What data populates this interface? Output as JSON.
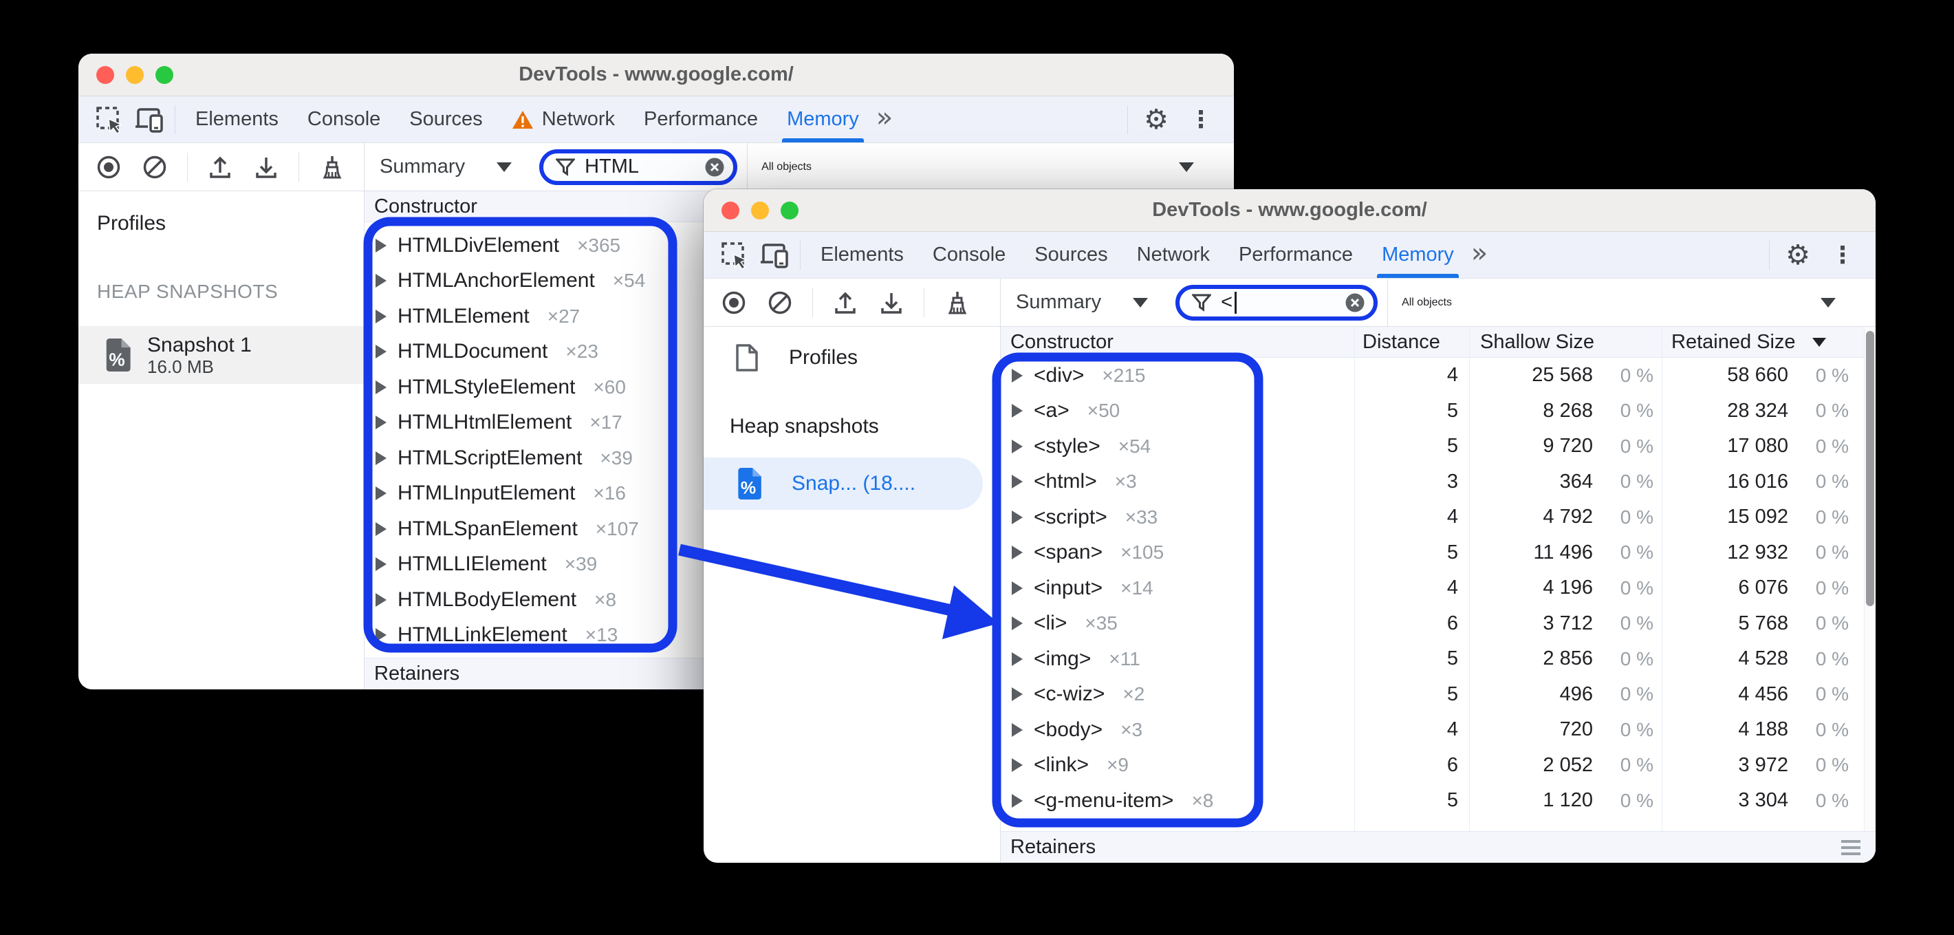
{
  "colors": {
    "accent_blue": "#1a73e8",
    "annotation_blue": "#1538e8",
    "warning_orange": "#e8710a",
    "traffic_red": "#ff5f57",
    "traffic_yellow": "#febc2e",
    "traffic_green": "#28c840"
  },
  "icons": {
    "gear": "⚙",
    "kebab": "⋮",
    "more_tabs": "»"
  },
  "back_window": {
    "title": "DevTools - www.google.com/",
    "tabs": [
      "Elements",
      "Console",
      "Sources",
      "Network",
      "Performance",
      "Memory"
    ],
    "selected_tab": "Memory",
    "toolbar": {
      "summary": "Summary",
      "filter": "HTML",
      "objects": "All objects"
    },
    "sidebar": {
      "profiles": "Profiles",
      "section": "HEAP SNAPSHOTS",
      "snapshot_name": "Snapshot 1",
      "snapshot_size": "16.0 MB"
    },
    "grid": {
      "constructor": "Constructor",
      "retainers": "Retainers",
      "rows": [
        {
          "name": "HTMLDivElement",
          "count": "×365"
        },
        {
          "name": "HTMLAnchorElement",
          "count": "×54"
        },
        {
          "name": "HTMLElement",
          "count": "×27"
        },
        {
          "name": "HTMLDocument",
          "count": "×23"
        },
        {
          "name": "HTMLStyleElement",
          "count": "×60"
        },
        {
          "name": "HTMLHtmlElement",
          "count": "×17"
        },
        {
          "name": "HTMLScriptElement",
          "count": "×39"
        },
        {
          "name": "HTMLInputElement",
          "count": "×16"
        },
        {
          "name": "HTMLSpanElement",
          "count": "×107"
        },
        {
          "name": "HTMLLIElement",
          "count": "×39"
        },
        {
          "name": "HTMLBodyElement",
          "count": "×8"
        },
        {
          "name": "HTMLLinkElement",
          "count": "×13"
        }
      ]
    }
  },
  "front_window": {
    "title": "DevTools - www.google.com/",
    "tabs": [
      "Elements",
      "Console",
      "Sources",
      "Network",
      "Performance",
      "Memory"
    ],
    "selected_tab": "Memory",
    "toolbar": {
      "summary": "Summary",
      "filter": "<",
      "objects": "All objects"
    },
    "sidebar": {
      "profiles": "Profiles",
      "section": "Heap snapshots",
      "snapshot_name": "Snap... (18...."
    },
    "grid": {
      "constructor": "Constructor",
      "distance": "Distance",
      "shallow": "Shallow Size",
      "retained": "Retained Size",
      "retainers": "Retainers",
      "rows": [
        {
          "name": "<div>",
          "count": "×215",
          "distance": "4",
          "shallow": "25 568",
          "shallow_pct": "0 %",
          "retained": "58 660",
          "retained_pct": "0 %"
        },
        {
          "name": "<a>",
          "count": "×50",
          "distance": "5",
          "shallow": "8 268",
          "shallow_pct": "0 %",
          "retained": "28 324",
          "retained_pct": "0 %"
        },
        {
          "name": "<style>",
          "count": "×54",
          "distance": "5",
          "shallow": "9 720",
          "shallow_pct": "0 %",
          "retained": "17 080",
          "retained_pct": "0 %"
        },
        {
          "name": "<html>",
          "count": "×3",
          "distance": "3",
          "shallow": "364",
          "shallow_pct": "0 %",
          "retained": "16 016",
          "retained_pct": "0 %"
        },
        {
          "name": "<script>",
          "count": "×33",
          "distance": "4",
          "shallow": "4 792",
          "shallow_pct": "0 %",
          "retained": "15 092",
          "retained_pct": "0 %"
        },
        {
          "name": "<span>",
          "count": "×105",
          "distance": "5",
          "shallow": "11 496",
          "shallow_pct": "0 %",
          "retained": "12 932",
          "retained_pct": "0 %"
        },
        {
          "name": "<input>",
          "count": "×14",
          "distance": "4",
          "shallow": "4 196",
          "shallow_pct": "0 %",
          "retained": "6 076",
          "retained_pct": "0 %"
        },
        {
          "name": "<li>",
          "count": "×35",
          "distance": "6",
          "shallow": "3 712",
          "shallow_pct": "0 %",
          "retained": "5 768",
          "retained_pct": "0 %"
        },
        {
          "name": "<img>",
          "count": "×11",
          "distance": "5",
          "shallow": "2 856",
          "shallow_pct": "0 %",
          "retained": "4 528",
          "retained_pct": "0 %"
        },
        {
          "name": "<c-wiz>",
          "count": "×2",
          "distance": "5",
          "shallow": "496",
          "shallow_pct": "0 %",
          "retained": "4 456",
          "retained_pct": "0 %"
        },
        {
          "name": "<body>",
          "count": "×3",
          "distance": "4",
          "shallow": "720",
          "shallow_pct": "0 %",
          "retained": "4 188",
          "retained_pct": "0 %"
        },
        {
          "name": "<link>",
          "count": "×9",
          "distance": "6",
          "shallow": "2 052",
          "shallow_pct": "0 %",
          "retained": "3 972",
          "retained_pct": "0 %"
        },
        {
          "name": "<g-menu-item>",
          "count": "×8",
          "distance": "5",
          "shallow": "1 120",
          "shallow_pct": "0 %",
          "retained": "3 304",
          "retained_pct": "0 %"
        }
      ]
    }
  }
}
